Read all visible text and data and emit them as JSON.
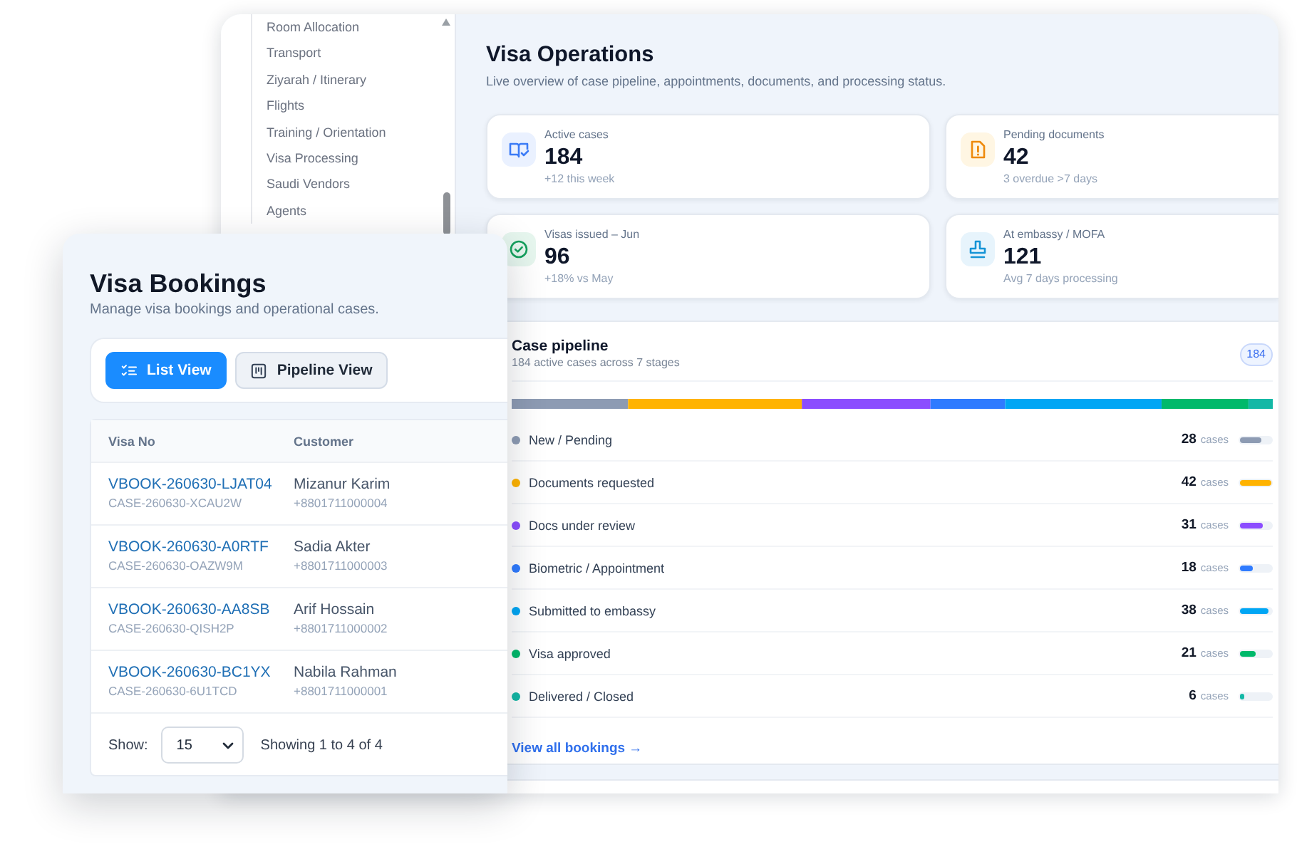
{
  "back_window": {
    "sidebar": {
      "items": [
        "Room Allocation",
        "Transport",
        "Ziyarah / Itinerary",
        "Flights",
        "Training / Orientation",
        "Visa Processing",
        "Saudi Vendors",
        "Agents"
      ]
    },
    "page_title": "Visa Operations",
    "page_subtitle": "Live overview of case pipeline, appointments, documents, and processing status.",
    "stats": [
      {
        "kind": "cases",
        "label": "Active cases",
        "value": "184",
        "note": "+12 this week"
      },
      {
        "kind": "documents",
        "label": "Pending documents",
        "value": "42",
        "note": "3 overdue >7 days"
      },
      {
        "kind": "issued",
        "label": "Visas issued – Jun",
        "value": "96",
        "note": "+18% vs May"
      },
      {
        "kind": "embassy",
        "label": "At embassy / MOFA",
        "value": "121",
        "note": "Avg 7 days processing"
      }
    ],
    "pipeline": {
      "title": "Case pipeline",
      "subtitle": "184 active cases across 7 stages",
      "badge": "184",
      "stages": [
        {
          "label": "New / Pending",
          "count": "28",
          "unit": "cases",
          "level": 0.67,
          "color": "#8d9bb3"
        },
        {
          "label": "Documents requested",
          "count": "42",
          "unit": "cases",
          "level": 1,
          "color": "#ffb300"
        },
        {
          "label": "Docs under review",
          "count": "31",
          "unit": "cases",
          "level": 0.74,
          "color": "#8b4dff"
        },
        {
          "label": "Biometric / Appointment",
          "count": "18",
          "unit": "cases",
          "level": 0.43,
          "color": "#2f7bff"
        },
        {
          "label": "Submitted to embassy",
          "count": "38",
          "unit": "cases",
          "level": 0.9,
          "color": "#00a6f4"
        },
        {
          "label": "Visa approved",
          "count": "21",
          "unit": "cases",
          "level": 0.5,
          "color": "#00b96b"
        },
        {
          "label": "Delivered / Closed",
          "count": "6",
          "unit": "cases",
          "level": 0.14,
          "color": "#14b8a6"
        }
      ],
      "link": "View all bookings →"
    }
  },
  "bookings_card": {
    "title": "Visa Bookings",
    "subtitle": "Manage visa bookings and operational cases.",
    "views": [
      {
        "kind": "list",
        "label": "List View",
        "selected": true
      },
      {
        "kind": "board",
        "label": "Pipeline View",
        "selected": false
      }
    ],
    "table": {
      "columns": [
        "Visa No",
        "Customer"
      ],
      "rows": [
        {
          "visa_no": "VBOOK-260630-LJAT04",
          "case_no": "CASE-260630-XCAU2W",
          "customer": "Mizanur Karim",
          "phone": "+8801711000004"
        },
        {
          "visa_no": "VBOOK-260630-A0RTF",
          "case_no": "CASE-260630-OAZW9M",
          "customer": "Sadia Akter",
          "phone": "+8801711000003"
        },
        {
          "visa_no": "VBOOK-260630-AA8SB",
          "case_no": "CASE-260630-QISH2P",
          "customer": "Arif Hossain",
          "phone": "+8801711000002"
        },
        {
          "visa_no": "VBOOK-260630-BC1YX",
          "case_no": "CASE-260630-6U1TCD",
          "customer": "Nabila Rahman",
          "phone": "+8801711000001"
        }
      ]
    },
    "footer": {
      "show_label": "Show:",
      "page_size": "15",
      "summary": "Showing 1 to 4 of 4"
    }
  }
}
